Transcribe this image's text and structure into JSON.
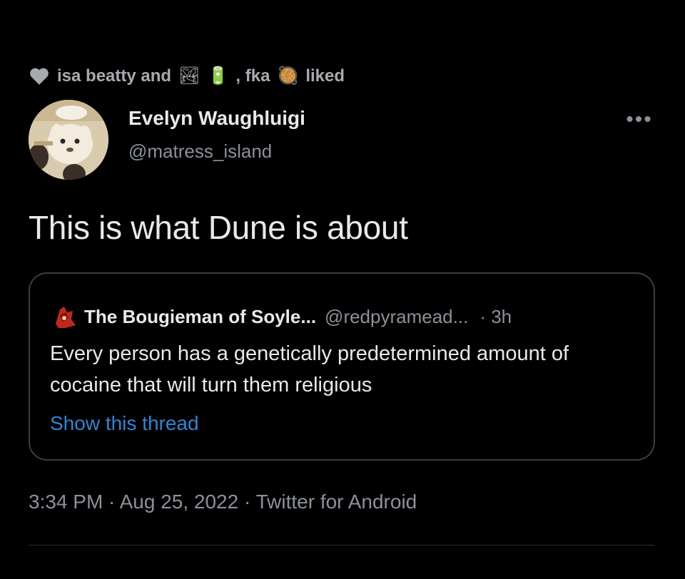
{
  "social_context": {
    "prefix": "isa beatty and",
    "emoji_one": "🏞",
    "emoji_two": "🔋",
    "separator": ", fka",
    "emoji_three": "🥘",
    "suffix": "liked"
  },
  "author": {
    "name": "Evelyn Waughluigi",
    "handle": "@matress_island"
  },
  "more_label": "•••",
  "tweet": {
    "text": "This is what Dune is about"
  },
  "quote": {
    "name": "The Bougieman of Soyle...",
    "handle": "@redpyramead...",
    "time": "· 3h",
    "text": "Every person has a genetically predetermined amount of cocaine that will turn them religious",
    "show_thread": "Show this thread"
  },
  "meta": {
    "timestamp": "3:34 PM · Aug 25, 2022 · Twitter for Android"
  },
  "colors": {
    "background": "#000000",
    "text_primary": "#e7e9ea",
    "text_secondary": "#8b9198",
    "link": "#2d86d4",
    "border": "#3a3f44"
  },
  "icons": {
    "like": "heart-icon",
    "more": "more-horizontal-icon"
  }
}
